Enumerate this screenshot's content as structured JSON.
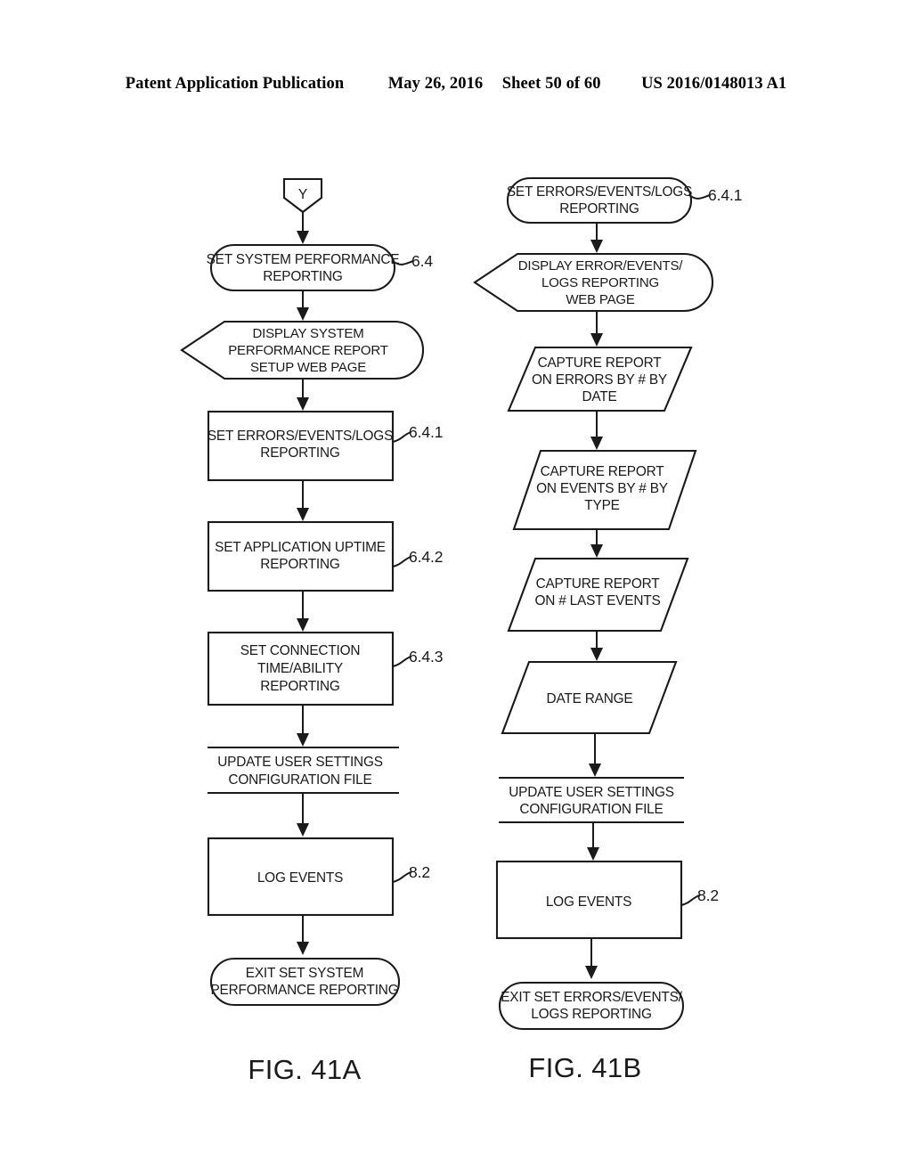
{
  "header": {
    "publication": "Patent Application Publication",
    "date": "May 26, 2016",
    "sheet": "Sheet 50 of 60",
    "document_number": "US 2016/0148013 A1"
  },
  "figures": [
    {
      "caption": "FIG. 41A",
      "nodes": [
        {
          "id": "a-connector",
          "shape": "connector-pentagon",
          "lines": [
            "Y"
          ]
        },
        {
          "id": "a-set-sys-perf",
          "shape": "stadium",
          "lines": [
            "SET SYSTEM PERFORMANCE",
            "REPORTING"
          ],
          "ref": "6.4"
        },
        {
          "id": "a-display-sys-perf",
          "shape": "display",
          "lines": [
            "DISPLAY SYSTEM",
            "PERFORMANCE REPORT",
            "SETUP WEB PAGE"
          ]
        },
        {
          "id": "a-set-errors",
          "shape": "rectangle",
          "lines": [
            "SET ERRORS/EVENTS/LOGS",
            "REPORTING"
          ],
          "ref": "6.4.1"
        },
        {
          "id": "a-set-app-uptime",
          "shape": "rectangle",
          "lines": [
            "SET APPLICATION UPTIME",
            "REPORTING"
          ],
          "ref": "6.4.2"
        },
        {
          "id": "a-set-connection",
          "shape": "rectangle",
          "lines": [
            "SET CONNECTION",
            "TIME/ABILITY",
            "REPORTING"
          ],
          "ref": "6.4.3"
        },
        {
          "id": "a-update-settings",
          "shape": "open-rules",
          "lines": [
            "UPDATE USER SETTINGS",
            "CONFIGURATION FILE"
          ]
        },
        {
          "id": "a-log-events",
          "shape": "rectangle",
          "lines": [
            "LOG EVENTS"
          ],
          "ref": "8.2"
        },
        {
          "id": "a-exit",
          "shape": "stadium",
          "lines": [
            "EXIT SET SYSTEM",
            "PERFORMANCE REPORTING"
          ]
        }
      ]
    },
    {
      "caption": "FIG. 41B",
      "nodes": [
        {
          "id": "b-set-errors",
          "shape": "stadium",
          "lines": [
            "SET ERRORS/EVENTS/LOGS",
            "REPORTING"
          ],
          "ref": "6.4.1"
        },
        {
          "id": "b-display-errors",
          "shape": "display",
          "lines": [
            "DISPLAY ERROR/EVENTS/",
            "LOGS REPORTING",
            "WEB PAGE"
          ]
        },
        {
          "id": "b-capture-errors",
          "shape": "parallelogram",
          "lines": [
            "CAPTURE REPORT",
            "ON ERRORS BY # BY",
            "DATE"
          ]
        },
        {
          "id": "b-capture-events",
          "shape": "parallelogram",
          "lines": [
            "CAPTURE REPORT",
            "ON EVENTS BY # BY",
            "TYPE"
          ]
        },
        {
          "id": "b-capture-last",
          "shape": "parallelogram",
          "lines": [
            "CAPTURE REPORT",
            "ON # LAST EVENTS"
          ]
        },
        {
          "id": "b-date-range",
          "shape": "parallelogram",
          "lines": [
            "DATE RANGE"
          ]
        },
        {
          "id": "b-update-settings",
          "shape": "open-rules",
          "lines": [
            "UPDATE USER SETTINGS",
            "CONFIGURATION FILE"
          ]
        },
        {
          "id": "b-log-events",
          "shape": "rectangle",
          "lines": [
            "LOG EVENTS"
          ],
          "ref": "8.2"
        },
        {
          "id": "b-exit",
          "shape": "stadium",
          "lines": [
            "EXIT SET ERRORS/EVENTS/",
            "LOGS REPORTING"
          ]
        }
      ]
    }
  ],
  "colors": {
    "ink": "#1a1a1a",
    "paper": "#ffffff"
  }
}
